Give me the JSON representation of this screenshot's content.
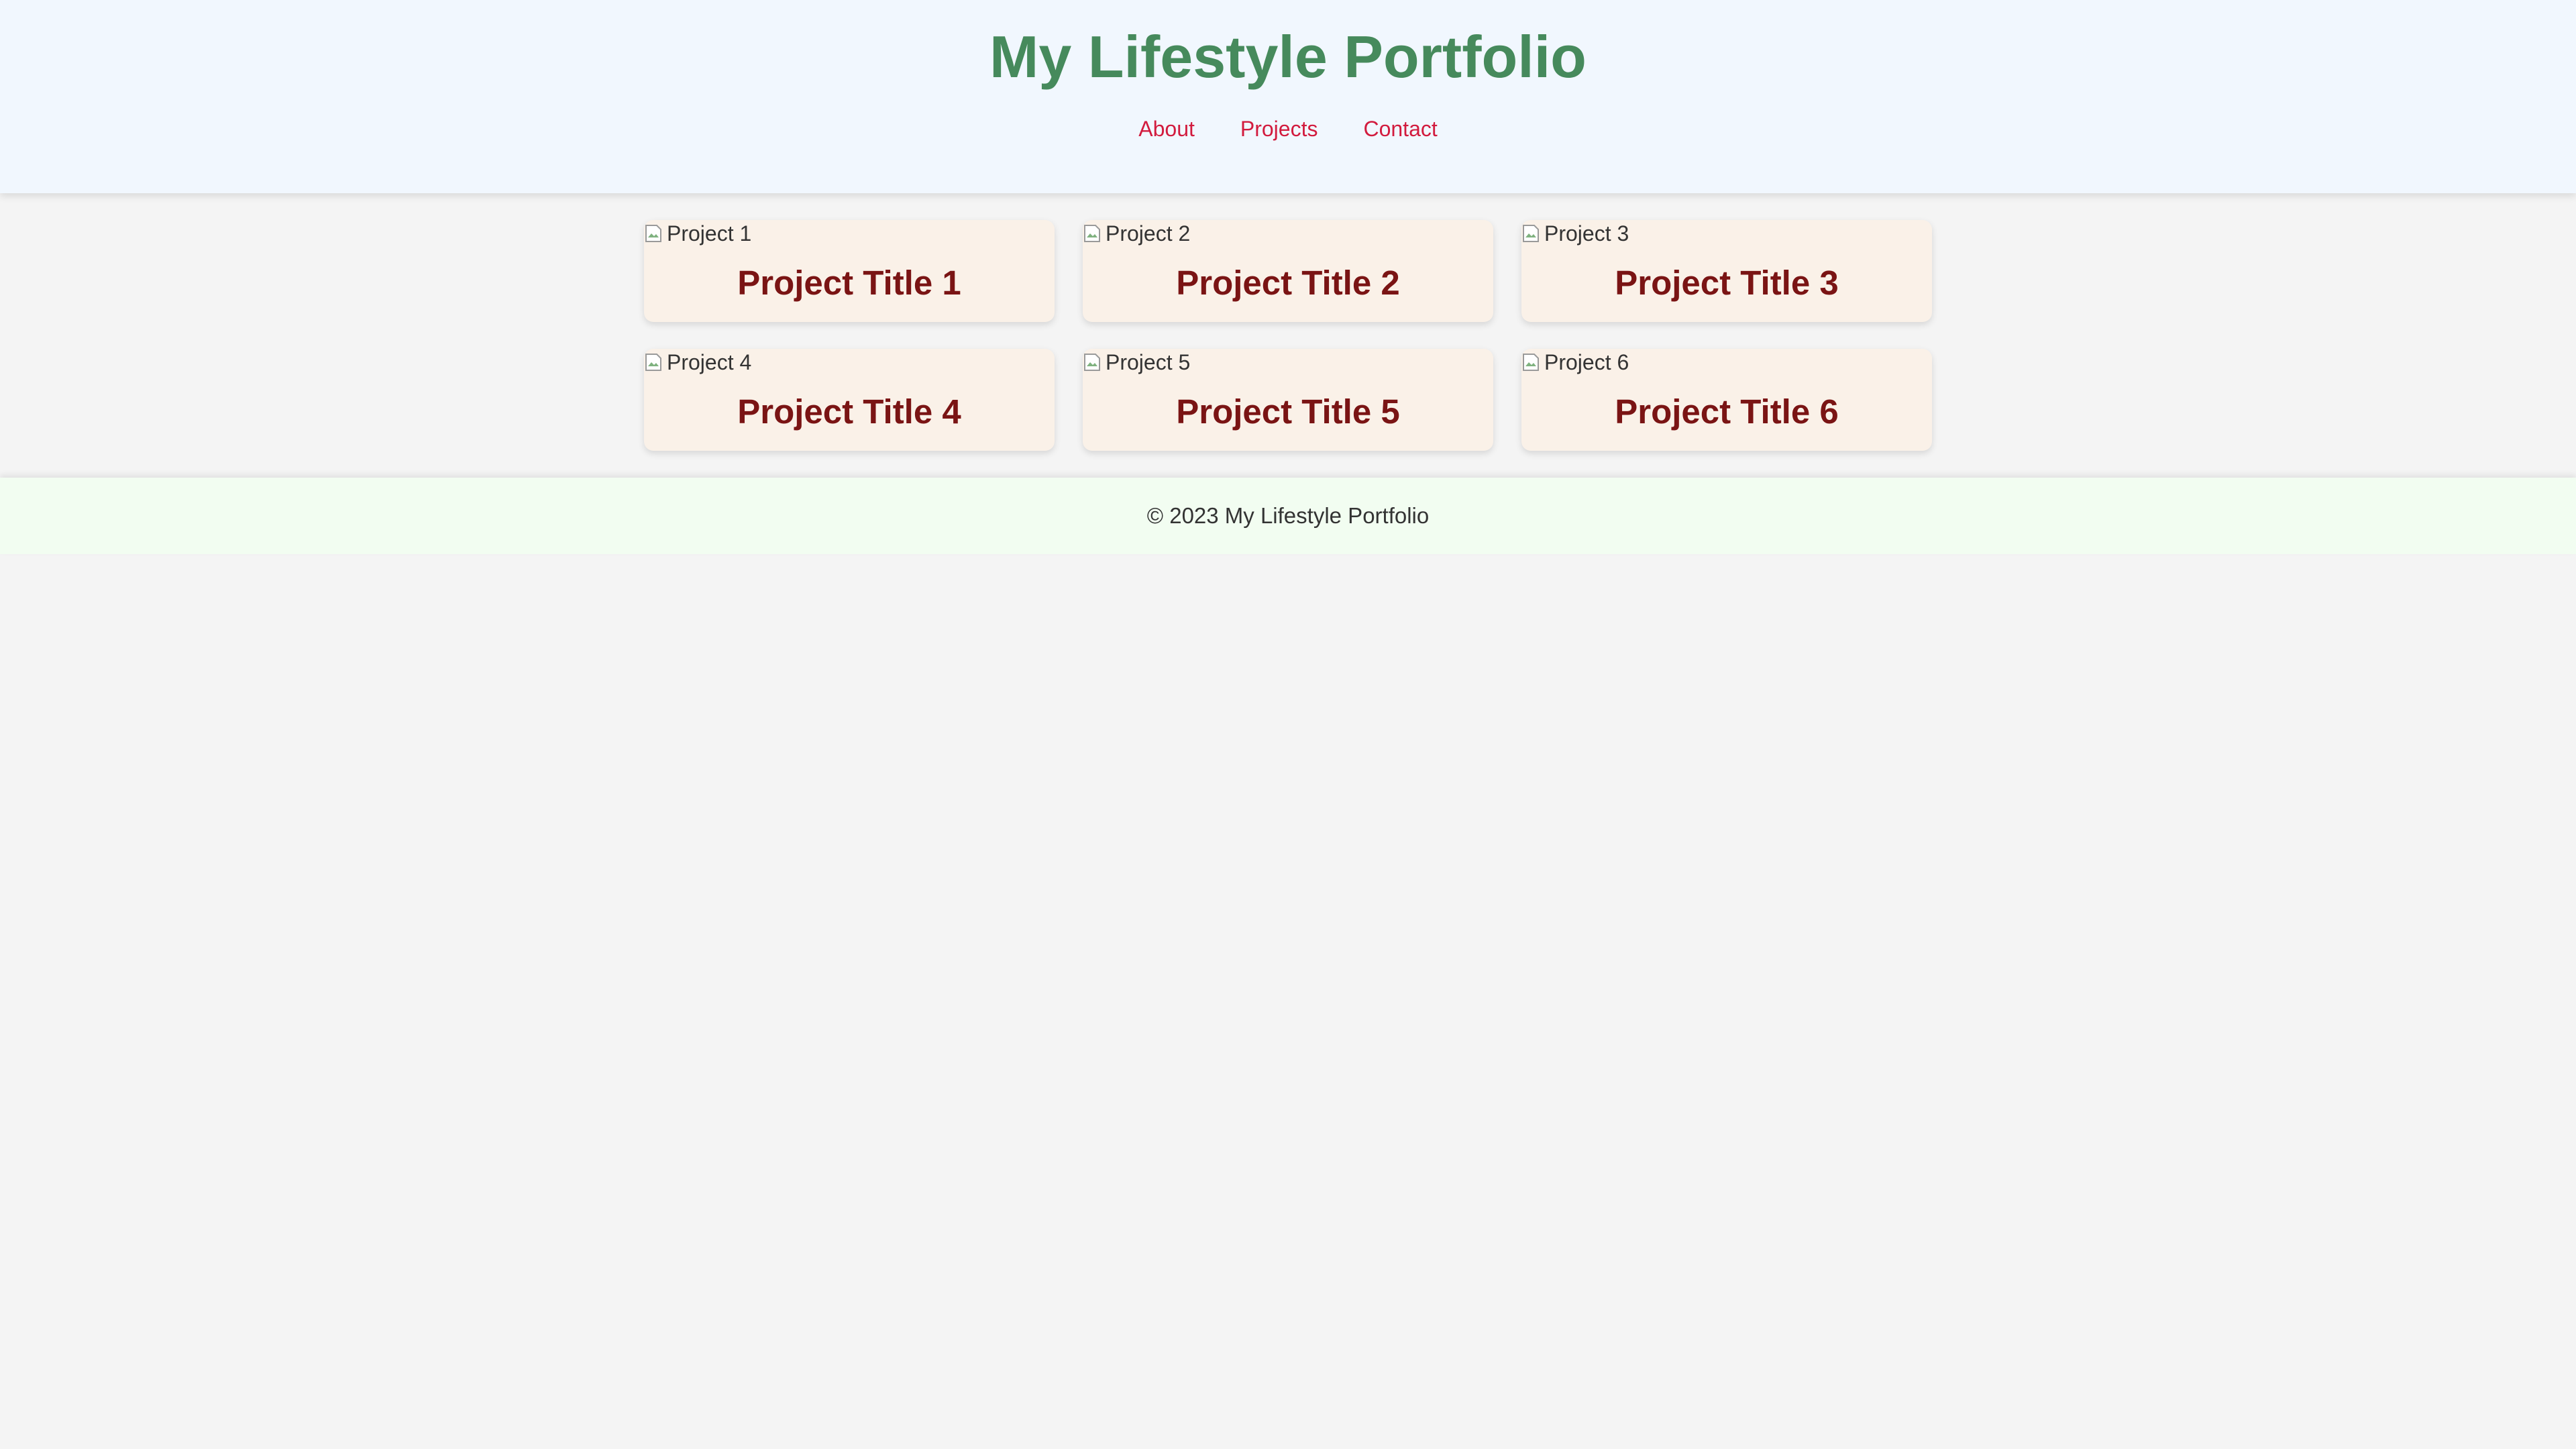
{
  "header": {
    "title": "My Lifestyle Portfolio",
    "nav": [
      {
        "label": "About"
      },
      {
        "label": "Projects"
      },
      {
        "label": "Contact"
      }
    ]
  },
  "projects": [
    {
      "image_alt": "Project 1",
      "title": "Project Title 1"
    },
    {
      "image_alt": "Project 2",
      "title": "Project Title 2"
    },
    {
      "image_alt": "Project 3",
      "title": "Project Title 3"
    },
    {
      "image_alt": "Project 4",
      "title": "Project Title 4"
    },
    {
      "image_alt": "Project 5",
      "title": "Project Title 5"
    },
    {
      "image_alt": "Project 6",
      "title": "Project Title 6"
    }
  ],
  "footer": {
    "text": "© 2023 My Lifestyle Portfolio"
  },
  "colors": {
    "header_bg": "#f1f7fe",
    "title": "#468a5c",
    "nav_link": "#d21b3e",
    "card_bg": "#faf1e8",
    "card_title": "#7a1414",
    "footer_bg": "#f2fdf1",
    "page_bg": "#f4f4f4"
  },
  "icons": {
    "project_image": "broken-image-icon"
  }
}
